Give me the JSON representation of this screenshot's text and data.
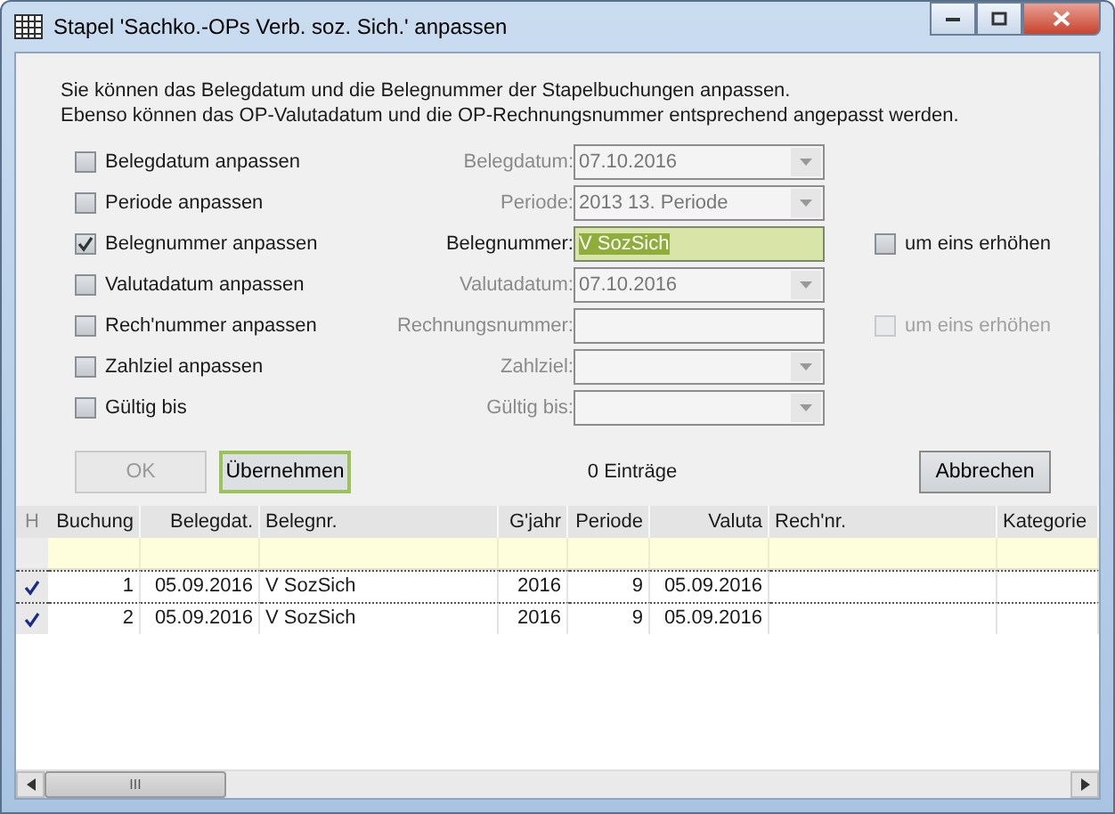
{
  "window": {
    "title": "Stapel 'Sachko.-OPs Verb. soz. Sich.' anpassen"
  },
  "intro": [
    "Sie können das Belegdatum und die Belegnummer der Stapelbuchungen anpassen.",
    "Ebenso können das OP-Valutadatum und die OP-Rechnungsnummer entsprechend angepasst werden."
  ],
  "options": [
    {
      "label": "Belegdatum anpassen",
      "checked": false,
      "field": {
        "label": "Belegdatum:",
        "kind": "combo",
        "value": "07.10.2016",
        "disabled": true,
        "highlighted": false
      }
    },
    {
      "label": "Periode anpassen",
      "checked": false,
      "field": {
        "label": "Periode:",
        "kind": "combo",
        "value": "2013  13. Periode",
        "disabled": true,
        "highlighted": false
      }
    },
    {
      "label": "Belegnummer anpassen",
      "checked": true,
      "field": {
        "label": "Belegnummer:",
        "kind": "text",
        "value": "V SozSich",
        "disabled": false,
        "highlighted": true
      },
      "extra": {
        "label": "um eins erhöhen",
        "checked": false,
        "disabled": false
      }
    },
    {
      "label": "Valutadatum anpassen",
      "checked": false,
      "field": {
        "label": "Valutadatum:",
        "kind": "combo",
        "value": "07.10.2016",
        "disabled": true,
        "highlighted": false
      }
    },
    {
      "label": "Rech'nummer anpassen",
      "checked": false,
      "field": {
        "label": "Rechnungsnummer:",
        "kind": "text",
        "disabled": true,
        "highlighted": false
      },
      "extra": {
        "label": "um eins erhöhen",
        "checked": false,
        "disabled": true
      }
    },
    {
      "label": "Zahlziel anpassen",
      "checked": false,
      "field": {
        "label": "Zahlziel:",
        "kind": "combo",
        "disabled": true,
        "highlighted": false
      }
    },
    {
      "label": "Gültig bis",
      "checked": false,
      "field": {
        "label": "Gültig bis:",
        "kind": "combo",
        "disabled": true,
        "highlighted": false
      }
    }
  ],
  "buttons": [
    {
      "label": "OK",
      "disabled": true,
      "default": false
    },
    {
      "label": "Übernehmen",
      "disabled": false,
      "default": true
    }
  ],
  "entries": "0 Einträge",
  "cancel": {
    "label": "Abbrechen"
  },
  "table": {
    "marker": "H",
    "columns": [
      "Buchung",
      "Belegdat.",
      "Belegnr.",
      "G'jahr",
      "Periode",
      "Valuta",
      "Rech'nr.",
      "Kategorie"
    ],
    "rows": [
      {
        "checked": true,
        "cells": [
          "1",
          "05.09.2016",
          "V SozSich",
          "2016",
          "9",
          "05.09.2016",
          "",
          ""
        ]
      },
      {
        "checked": true,
        "cells": [
          "2",
          "05.09.2016",
          "V SozSich",
          "2016",
          "9",
          "05.09.2016",
          "",
          ""
        ]
      }
    ]
  },
  "scrollbar": {
    "thumb": "III"
  }
}
